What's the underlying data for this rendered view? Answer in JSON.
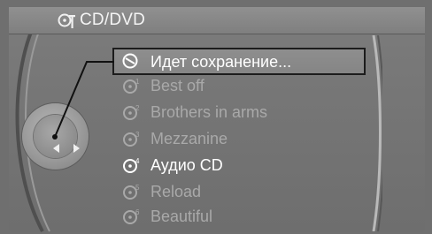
{
  "header": {
    "title": "CD/DVD",
    "icon": "cd-changer-icon"
  },
  "menu": {
    "items": [
      {
        "label": "Идет сохранение...",
        "icon": "cd-disc-icon",
        "state": "selected"
      },
      {
        "label": "Best off",
        "icon": "cd-disc-1-icon",
        "state": "dim"
      },
      {
        "label": "Brothers in arms",
        "icon": "cd-disc-2-icon",
        "state": "dim"
      },
      {
        "label": "Mezzanine",
        "icon": "cd-disc-3-icon",
        "state": "dim"
      },
      {
        "label": "Аудио CD",
        "icon": "cd-disc-4-icon",
        "state": "active"
      },
      {
        "label": "Reload",
        "icon": "cd-disc-5-icon",
        "state": "dim"
      },
      {
        "label": "Beautiful",
        "icon": "cd-disc-6-icon",
        "state": "dim"
      }
    ]
  },
  "colors": {
    "background": "#7a7a7a",
    "text_bright": "#ffffff",
    "text_dim": "#a9a9a9",
    "selection_border": "#1c1c1c"
  }
}
